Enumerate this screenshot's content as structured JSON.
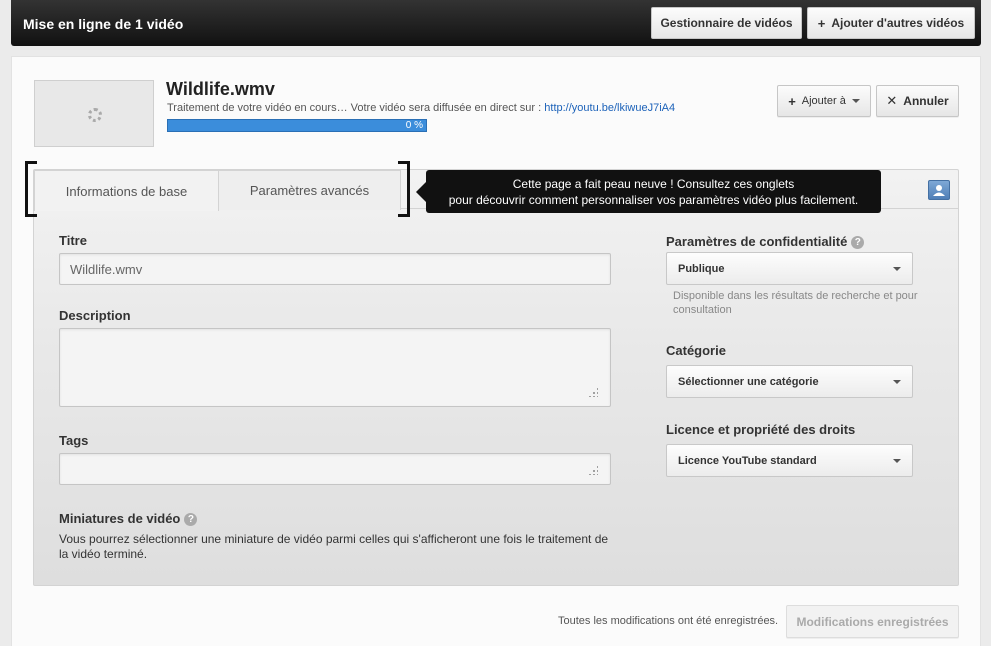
{
  "header": {
    "title": "Mise en ligne de 1 vidéo",
    "video_manager_label": "Gestionnaire de vidéos",
    "add_more_label": "Ajouter d'autres vidéos",
    "add_more_icon": "plus-icon"
  },
  "video": {
    "title": "Wildlife.wmv",
    "status_text": "Traitement de votre vidéo en cours… Votre vidéo sera diffusée en direct sur :",
    "link": "http://youtu.be/lkiwueJ7iA4",
    "progress_label": "0 %",
    "progress_value": 0,
    "add_to_label": "Ajouter à",
    "cancel_label": "Annuler"
  },
  "tabs": [
    {
      "label": "Informations de base",
      "active": true
    },
    {
      "label": "Paramètres avancés",
      "active": false
    }
  ],
  "tooltip": {
    "line1": "Cette page a fait peau neuve ! Consultez ces onglets",
    "line2": "pour découvrir comment personnaliser vos paramètres vidéo plus facilement."
  },
  "form": {
    "title_label": "Titre",
    "title_value": "Wildlife.wmv",
    "description_label": "Description",
    "description_value": "",
    "tags_label": "Tags",
    "tags_value": "",
    "thumbnails_label": "Miniatures de vidéo",
    "thumbnails_text": "Vous pourrez sélectionner une miniature de vidéo parmi celles qui s'afficheront une fois le traitement de la vidéo terminé."
  },
  "settings": {
    "privacy_label": "Paramètres de confidentialité",
    "privacy_value": "Publique",
    "privacy_note": "Disponible dans les résultats de recherche et pour consultation",
    "category_label": "Catégorie",
    "category_value": "Sélectionner une catégorie",
    "license_label": "Licence et propriété des droits",
    "license_value": "Licence YouTube standard"
  },
  "footer": {
    "status": "Toutes les modifications ont été enregistrées.",
    "saved_button_label": "Modifications enregistrées"
  },
  "colors": {
    "link": "#1c62b9",
    "progress": "#3b8ddb",
    "header_bg": "#1a1a1a"
  }
}
